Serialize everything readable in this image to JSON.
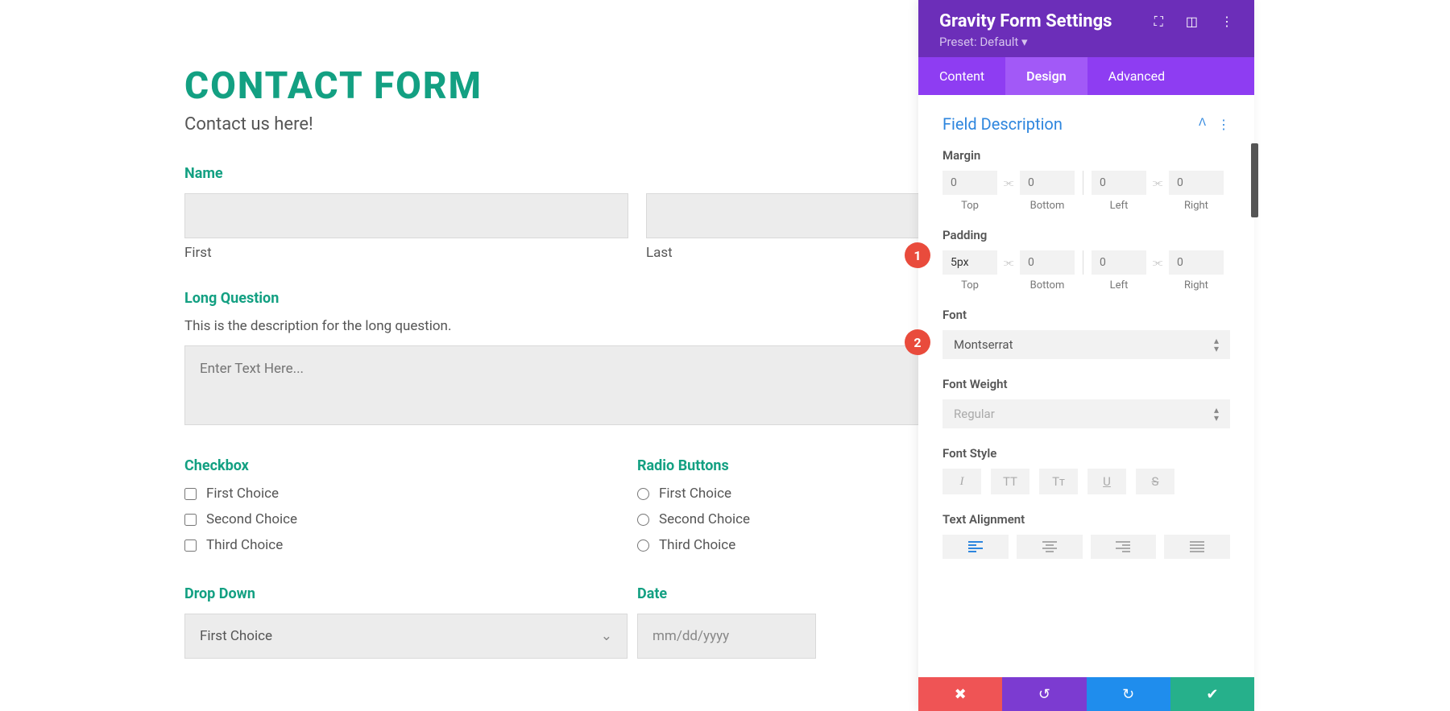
{
  "form": {
    "title": "CONTACT FORM",
    "subtitle": "Contact us here!",
    "name": {
      "label": "Name",
      "first": "First",
      "last": "Last"
    },
    "long": {
      "label": "Long Question",
      "desc": "This is the description for the long question.",
      "placeholder": "Enter Text Here..."
    },
    "checkbox": {
      "label": "Checkbox",
      "options": [
        "First Choice",
        "Second Choice",
        "Third Choice"
      ]
    },
    "radio": {
      "label": "Radio Buttons",
      "options": [
        "First Choice",
        "Second Choice",
        "Third Choice"
      ]
    },
    "dropdown": {
      "label": "Drop Down",
      "selected": "First Choice"
    },
    "date": {
      "label": "Date",
      "placeholder": "mm/dd/yyyy"
    }
  },
  "panel": {
    "title": "Gravity Form Settings",
    "preset": "Preset: Default ▾",
    "tabs": {
      "content": "Content",
      "design": "Design",
      "advanced": "Advanced"
    },
    "section": "Field Description",
    "margin": {
      "label": "Margin",
      "top": "Top",
      "bottom": "Bottom",
      "left": "Left",
      "right": "Right",
      "topVal": "0",
      "bottomVal": "0",
      "leftVal": "0",
      "rightVal": "0"
    },
    "padding": {
      "label": "Padding",
      "top": "Top",
      "bottom": "Bottom",
      "left": "Left",
      "right": "Right",
      "topVal": "5px",
      "bottomVal": "0",
      "leftVal": "0",
      "rightVal": "0"
    },
    "font": {
      "label": "Font",
      "value": "Montserrat"
    },
    "fontWeight": {
      "label": "Font Weight",
      "value": "Regular"
    },
    "fontStyle": {
      "label": "Font Style"
    },
    "textAlign": {
      "label": "Text Alignment"
    },
    "styleLabels": {
      "italic": "I",
      "upper": "TT",
      "small": "Tᴛ",
      "underline": "U",
      "strike": "S"
    }
  },
  "badges": {
    "one": "1",
    "two": "2"
  }
}
